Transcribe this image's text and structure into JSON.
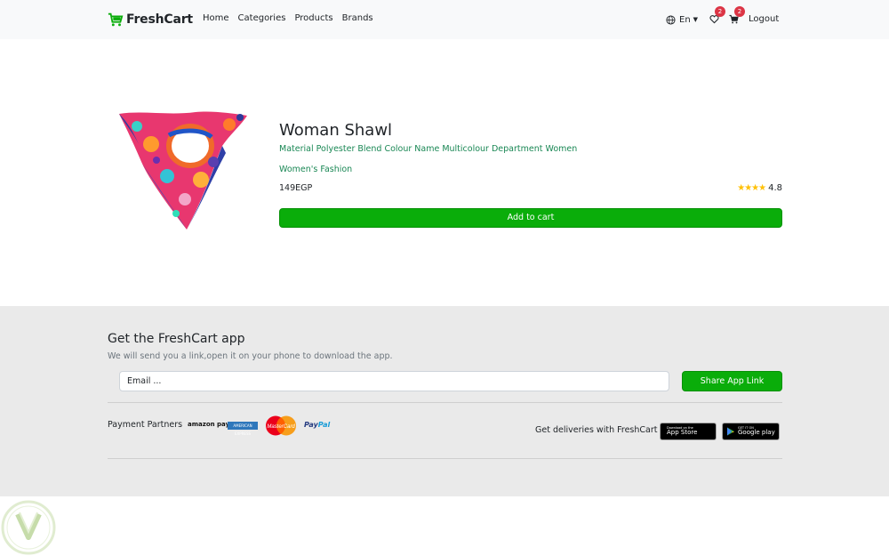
{
  "navbar": {
    "brand": "FreshCart",
    "links": [
      "Home",
      "Categories",
      "Products",
      "Brands"
    ],
    "language": "En",
    "wishlist_count": "2",
    "cart_count": "2",
    "logout": "Logout"
  },
  "product": {
    "title": "Woman Shawl",
    "description": "Material Polyester Blend Colour Name Multicolour Department Women",
    "category": "Women's Fashion",
    "price": "149EGP",
    "stars": "★★★★",
    "rating": "4.8",
    "add_to_cart": "Add to cart"
  },
  "footer": {
    "title": "Get the FreshCart app",
    "subtitle": "We will send you a link,open it on your phone to download the app.",
    "email_placeholder": "Email ...",
    "share_button": "Share App Link",
    "payment_label": "Payment Partners",
    "payment_partners": {
      "amazon": "amazon pay",
      "amex": "AMERICAN EXPRESS",
      "mastercard": "MasterCard",
      "paypal_a": "Pay",
      "paypal_b": "Pal"
    },
    "delivery_label": "Get deliveries with FreshCart",
    "app_store": {
      "small": "Download on the",
      "big": "App Store"
    },
    "google_play": {
      "small": "GET IT ON",
      "big": "Google play"
    }
  },
  "colors": {
    "primary_green": "#0aad0a",
    "link_green": "#198754",
    "badge_red": "#dc3545",
    "footer_bg": "#eaeaea",
    "navbar_bg": "#f8f9fa",
    "star": "#ffc107"
  },
  "icons": [
    "cart-logo-icon",
    "globe-icon",
    "caret-down-icon",
    "heart-icon",
    "cart-icon",
    "apple-icon",
    "play-icon"
  ]
}
